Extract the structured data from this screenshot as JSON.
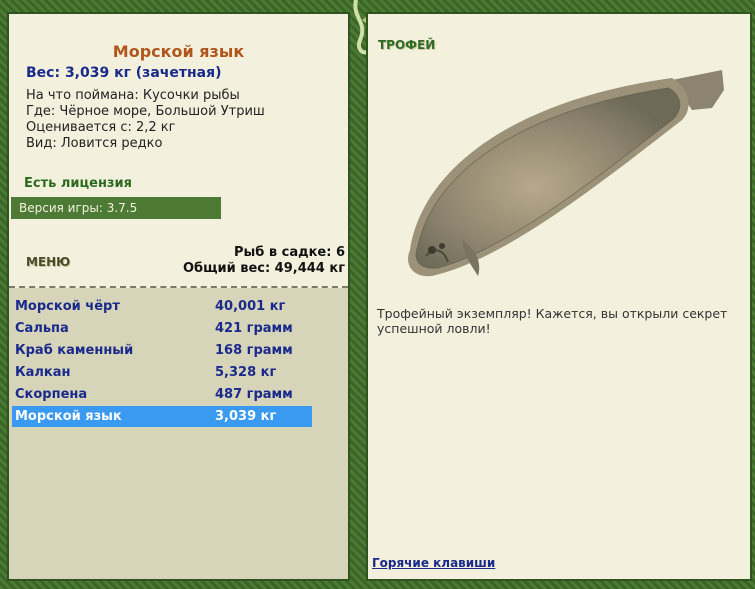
{
  "fish": {
    "title": "Морской язык",
    "weight_line": "Вес: 3,039 кг (зачетная)",
    "info": [
      "На что поймана: Кусочки рыбы",
      "Где: Чёрное море, Большой Утриш",
      "Оценивается с: 2,2 кг",
      "Вид: Ловится редко"
    ]
  },
  "license": "Есть лицензия",
  "version": "Версия игры: 3.7.5",
  "menu_label": "МЕНЮ",
  "stats": {
    "count_line": "Рыб в садке: 6",
    "total_line": "Общий вес: 49,444 кг"
  },
  "catch_list": [
    {
      "name": "Морской чёрт",
      "weight": "40,001 кг",
      "selected": false
    },
    {
      "name": "Сальпа",
      "weight": "421 грамм",
      "selected": false
    },
    {
      "name": "Краб каменный",
      "weight": "168 грамм",
      "selected": false
    },
    {
      "name": "Калкан",
      "weight": "5,328 кг",
      "selected": false
    },
    {
      "name": "Скорпена",
      "weight": "487 грамм",
      "selected": false
    },
    {
      "name": "Морской язык",
      "weight": "3,039 кг",
      "selected": true
    }
  ],
  "trophy": {
    "title": "ТРОФЕЙ",
    "text": "Трофейный экземпляр! Кажется, вы открыли секрет успешной ловли!"
  },
  "hotkeys_link": "Горячие клавиши",
  "colors": {
    "frame": "#3f6a2c",
    "panel": "#f3f1de",
    "list_bg": "#d6d4b9",
    "selected_row": "#3a99f0",
    "title": "#b0561d",
    "link": "#1a2a8c"
  }
}
